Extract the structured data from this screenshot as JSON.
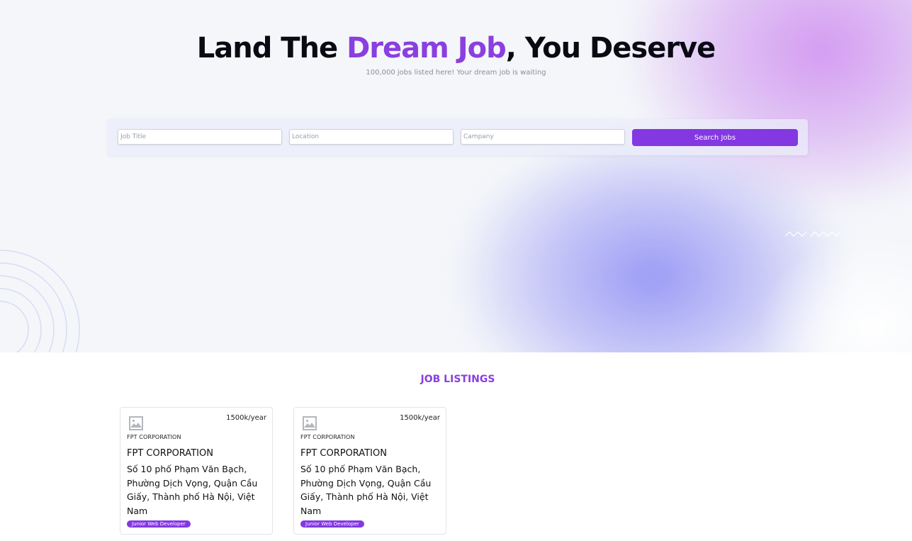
{
  "hero": {
    "headline_part1": "Land The ",
    "headline_accent": "Dream Job",
    "headline_part2": ", You Deserve",
    "subtitle": "100,000 jobs listed here! Your dream job is waiting"
  },
  "search": {
    "job_title_placeholder": "Job Title",
    "location_placeholder": "Location",
    "company_placeholder": "Campany",
    "button_label": "Search Jobs"
  },
  "listings": {
    "title": "JOB LISTINGS",
    "jobs": [
      {
        "logo_icon": "image-placeholder-icon",
        "salary": "1500k/year",
        "company_small": "FPT CORPORATION",
        "company": "FPT CORPORATION",
        "address": "Số 10 phố Phạm Văn Bạch, Phường Dịch Vọng, Quận Cầu Giấy, Thành phố Hà Nội, Việt Nam",
        "tag": "Junior Web Developer"
      },
      {
        "logo_icon": "image-placeholder-icon",
        "salary": "1500k/year",
        "company_small": "FPT CORPORATION",
        "company": "FPT CORPORATION",
        "address": "Số 10 phố Phạm Văn Bạch, Phường Dịch Vọng, Quận Cầu Giấy, Thành phố Hà Nội, Việt Nam",
        "tag": "Junior Web Developer"
      }
    ]
  },
  "colors": {
    "accent": "#8a3fe0",
    "button": "#8338e2",
    "hero_background": "#f4f6fa",
    "blob_pink": "#d296f0",
    "blob_blue": "#9696f5"
  }
}
